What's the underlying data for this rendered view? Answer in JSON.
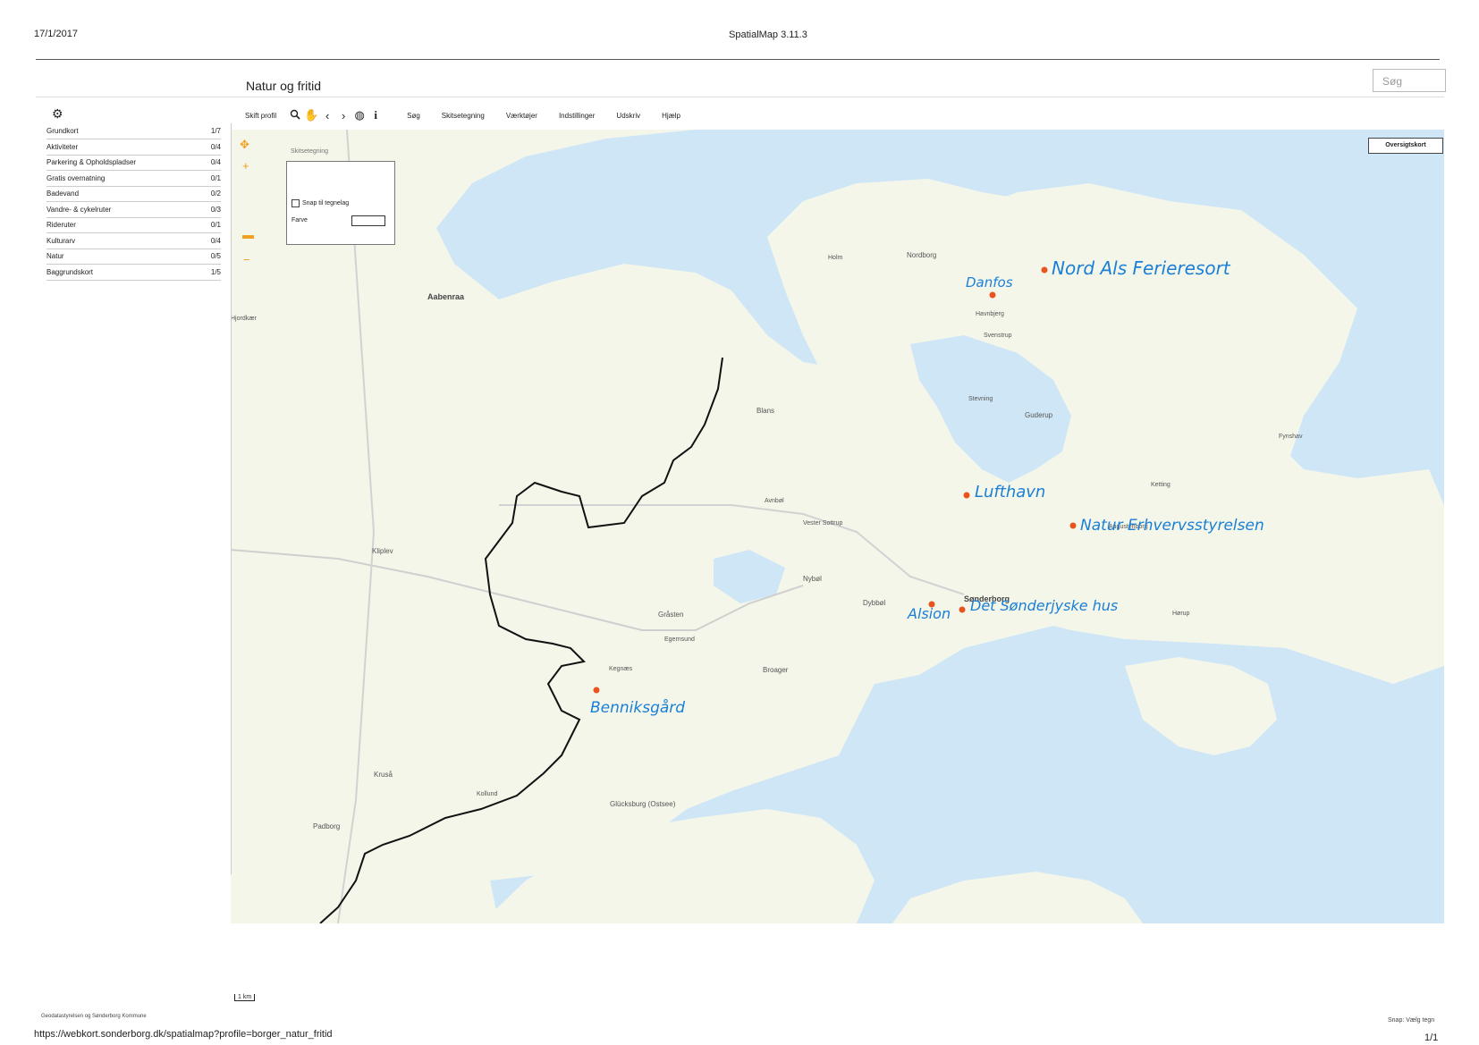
{
  "header": {
    "date": "17/1/2017",
    "title": "SpatialMap 3.11.3"
  },
  "app": {
    "title": "Natur og fritid",
    "search_placeholder": "Søg"
  },
  "toolbar": {
    "switch_profile": "Skift profil",
    "menu": [
      "Søg",
      "Skitsetegning",
      "Værktøjer",
      "Indstillinger",
      "Udskriv",
      "Hjælp"
    ],
    "icons": [
      "zoom-icon",
      "pan-icon",
      "back-icon",
      "forward-icon",
      "globe-icon",
      "info-icon"
    ]
  },
  "layers": [
    {
      "name": "Grundkort",
      "count": "1/7"
    },
    {
      "name": "Aktiviteter",
      "count": "0/4"
    },
    {
      "name": "Parkering & Opholdspladser",
      "count": "0/4"
    },
    {
      "name": "Gratis overnatning",
      "count": "0/1"
    },
    {
      "name": "Badevand",
      "count": "0/2"
    },
    {
      "name": "Vandre- & cykelruter",
      "count": "0/3"
    },
    {
      "name": "Rideruter",
      "count": "0/1"
    },
    {
      "name": "Kulturarv",
      "count": "0/4"
    },
    {
      "name": "Natur",
      "count": "0/5"
    },
    {
      "name": "Baggrundskort",
      "count": "1/5"
    }
  ],
  "sketch": {
    "title": "Skitsetegning",
    "snap_label": "Snap til tegnelag",
    "color_label": "Farve"
  },
  "overview_button": "Oversigtskort",
  "map": {
    "place_labels": [
      "Aabenraa",
      "Sønderborg",
      "Nordborg",
      "Gråsten",
      "Broager",
      "Guderup",
      "Blans",
      "Kliplev",
      "Kruså",
      "Padborg",
      "Holm",
      "Hjordkær",
      "Fynshav",
      "Dybbøl",
      "Nybøl",
      "Egernsund",
      "Glücksburg (Ostsee)",
      "Kollund",
      "Havnbjerg",
      "Svenstrup",
      "Augustenborg",
      "Vester Sottrup",
      "Avnbøl",
      "Hørup",
      "Ketting",
      "Stevning",
      "Kegnæs"
    ],
    "handwritten": [
      "Nord Als Ferieresort",
      "Danfos",
      "Lufthavn",
      "Natur Erhvervsstyrelsen",
      "Alsion",
      "Det Sønderjyske hus",
      "Benniksgård"
    ]
  },
  "footer": {
    "scale": "1 km",
    "credit": "Geodatastyrelsen og Sønderborg Kommune",
    "url": "https://webkort.sonderborg.dk/spatialmap?profile=borger_natur_fritid",
    "page": "1/1",
    "snap": "Snap: Vælg tegn"
  },
  "colors": {
    "water": "#cfe6f7",
    "land": "#f4f6ea",
    "marker": "#e8531e",
    "handwriting": "#1a7fd6",
    "border": "#111111"
  }
}
